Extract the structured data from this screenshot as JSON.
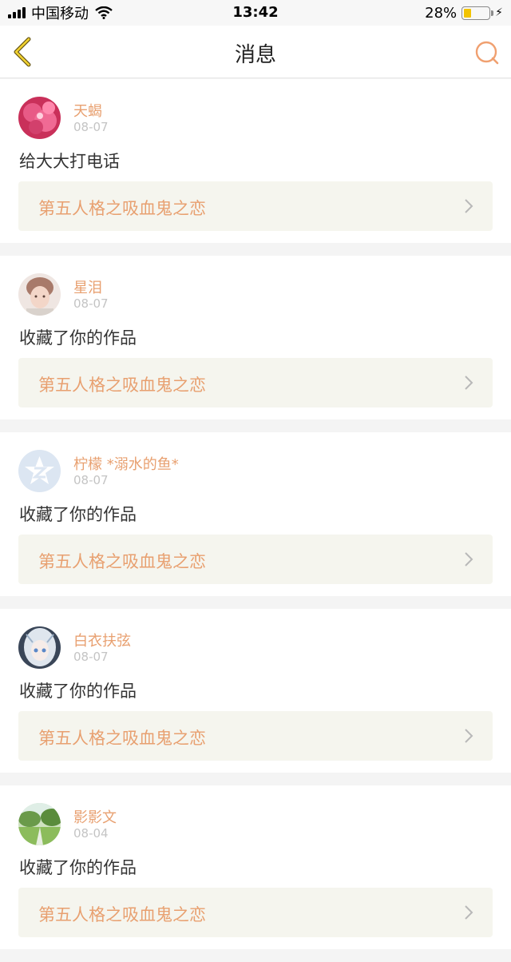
{
  "status_bar": {
    "carrier": "中国移动",
    "time": "13:42",
    "battery_percent": "28%",
    "battery_level": 0.28
  },
  "nav": {
    "title": "消息",
    "back_icon": "back-chevron-icon",
    "search_icon": "search-icon",
    "accent_color": "#e8a070"
  },
  "messages": [
    {
      "username": "天蝎",
      "date": "08-07",
      "action": "给大大打电话",
      "work_title": "第五人格之吸血鬼之恋",
      "avatar": "flower-avatar"
    },
    {
      "username": "星泪",
      "date": "08-07",
      "action": "收藏了你的作品",
      "work_title": "第五人格之吸血鬼之恋",
      "avatar": "person-avatar"
    },
    {
      "username": "柠檬 *溺水的鱼*",
      "date": "08-07",
      "action": "收藏了你的作品",
      "work_title": "第五人格之吸血鬼之恋",
      "avatar": "qzone-star-avatar"
    },
    {
      "username": "白衣扶弦",
      "date": "08-07",
      "action": "收藏了你的作品",
      "work_title": "第五人格之吸血鬼之恋",
      "avatar": "anime-girl-avatar"
    },
    {
      "username": "影影文",
      "date": "08-04",
      "action": "收藏了你的作品",
      "work_title": "第五人格之吸血鬼之恋",
      "avatar": "landscape-avatar"
    }
  ]
}
